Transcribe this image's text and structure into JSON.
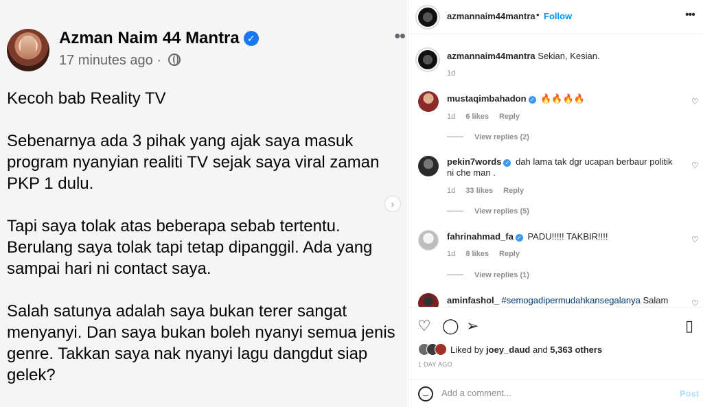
{
  "post_image": {
    "author": "Azman Naim 44 Mantra",
    "time": "17 minutes ago ·",
    "paragraphs": [
      "Kecoh bab Reality TV",
      "Sebenarnya ada 3 pihak yang ajak saya masuk program nyanyian realiti TV sejak saya viral zaman PKP 1 dulu.",
      "Tapi saya tolak atas beberapa sebab tertentu. Berulang saya tolak tapi tetap dipanggil. Ada yang sampai hari ni contact saya.",
      "Salah satunya adalah saya bukan terer sangat menyanyi. Dan saya bukan boleh nyanyi semua jenis genre. Takkan saya nak nyanyi lagu dangdut siap gelek?"
    ],
    "icons": {
      "verified": "verified-badge-icon",
      "globe": "globe-icon",
      "more": "more-options-icon",
      "next": "chevron-right-icon"
    }
  },
  "header": {
    "username": "azmannaim44mantra",
    "separator": "•",
    "follow_label": "Follow",
    "more": "•••"
  },
  "caption": {
    "username": "azmannaim44mantra",
    "text": "Sekian, Kesian.",
    "time": "1d"
  },
  "comments": [
    {
      "username": "mustaqimbahadon",
      "verified": true,
      "text": "🔥🔥🔥🔥",
      "time": "1d",
      "likes": "6 likes",
      "reply": "Reply",
      "view_replies": "View replies (2)",
      "avatar_color": "#8b2a2a"
    },
    {
      "username": "pekin7words",
      "verified": true,
      "text": "dah lama tak dgr ucapan berbaur politik ni che man .",
      "time": "1d",
      "likes": "33 likes",
      "reply": "Reply",
      "view_replies": "View replies (5)",
      "avatar_color": "#2b2b2b"
    },
    {
      "username": "fahrinahmad_fa",
      "verified": true,
      "text": "PADU!!!!! TAKBIR!!!!",
      "time": "1d",
      "likes": "8 likes",
      "reply": "Reply",
      "view_replies": "View replies (1)",
      "avatar_color": "#d9d9d9"
    },
    {
      "username": "aminfashol_",
      "verified": false,
      "hashtag": "#semogadipermudahkansegalanya",
      "text": "Salam",
      "avatar_color": "#7a2020"
    }
  ],
  "actions": {
    "liked_by_prefix": "Liked by",
    "liked_by_user": "joey_daud",
    "liked_by_and": "and",
    "liked_by_others": "5,363 others",
    "date": "1 DAY AGO",
    "comment_placeholder": "Add a comment...",
    "post_label": "Post",
    "like_avatar_colors": [
      "#6b6b6b",
      "#3a3a3a",
      "#a0302a"
    ]
  }
}
